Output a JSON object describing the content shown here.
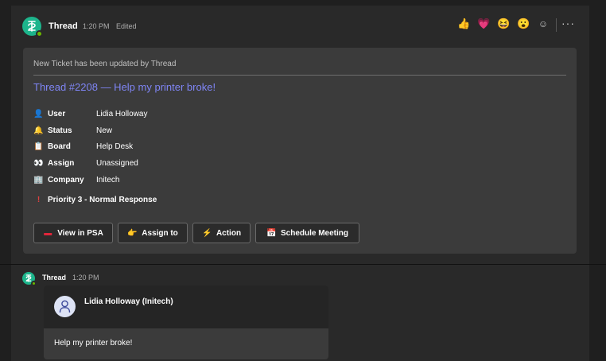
{
  "message1": {
    "sender": "Thread",
    "time": "1:20 PM",
    "edited": "Edited",
    "reactions": [
      "👍",
      "💗",
      "😆",
      "😮",
      "☺"
    ],
    "card": {
      "subtitle": "New Ticket has been updated by Thread",
      "title": "Thread #2208 — Help my printer broke!",
      "facts": [
        {
          "icon": "👤",
          "key": "User",
          "value": "Lidia Holloway"
        },
        {
          "icon": "🔔",
          "key": "Status",
          "value": "New"
        },
        {
          "icon": "📋",
          "key": "Board",
          "value": "Help Desk"
        },
        {
          "icon": "👀",
          "key": "Assign",
          "value": "Unassigned"
        },
        {
          "icon": "🏢",
          "key": "Company",
          "value": "Initech"
        }
      ],
      "priority": {
        "icon": "!",
        "label": "Priority 3 - Normal Response"
      },
      "buttons": [
        {
          "icon": "▬",
          "label": "View in PSA"
        },
        {
          "icon": "👉",
          "label": "Assign to"
        },
        {
          "icon": "⚡",
          "label": "Action"
        },
        {
          "icon": "📅",
          "label": "Schedule Meeting"
        }
      ]
    }
  },
  "message2": {
    "sender": "Thread",
    "time": "1:20 PM",
    "card": {
      "name": "Lidia Holloway (Initech)",
      "body": "Help my printer broke!"
    }
  },
  "colors": {
    "accent_link": "#7f85f5",
    "bot_avatar": "#1db58c",
    "presence": "#6bb700",
    "background": "#1f1f1f",
    "surface": "#292929",
    "card": "#3b3b3b"
  }
}
